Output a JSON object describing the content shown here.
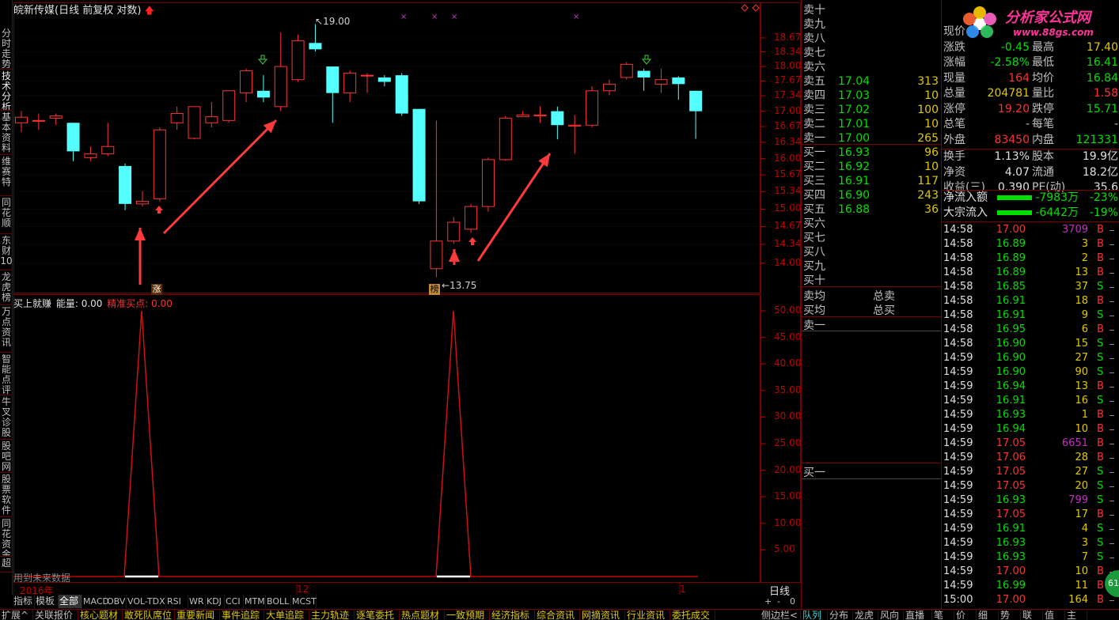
{
  "window": {
    "title": "皖新传媒(日线 前复权 对数)"
  },
  "left_tabs": [
    {
      "label": "分时走势"
    },
    {
      "label": "技术分析"
    },
    {
      "label": "基本资料"
    },
    {
      "label": "维赛特"
    },
    {
      "label": "同花顺"
    },
    {
      "label": "东财10"
    },
    {
      "label": "龙虎榜"
    },
    {
      "label": "万点资讯"
    },
    {
      "label": "智能点评"
    },
    {
      "label": "牛叉诊股"
    },
    {
      "label": "股吧网"
    },
    {
      "label": "股票软件"
    },
    {
      "label": "同花资金"
    },
    {
      "label": "超"
    }
  ],
  "main_chart": {
    "price_labels": {
      "high": "19.00",
      "low": "13.75"
    },
    "markers": {
      "zhang": "涨",
      "bang": "榜"
    },
    "y_ticks": [
      "18.67",
      "18.34",
      "18.00",
      "17.67",
      "17.34",
      "17.00",
      "16.67",
      "16.34",
      "16.00",
      "15.67",
      "15.34",
      "15.00",
      "14.67",
      "14.34",
      "14.00"
    ],
    "colors": {
      "up": "#ff3232",
      "down": "#54ffff",
      "grid": "#7a0000"
    }
  },
  "indicator": {
    "name": "买上就赚",
    "energy_label": "能量: 0.00",
    "signal_label": "精准买点: 0.00",
    "note": "用到未来数据",
    "y_ticks": [
      "50.00",
      "45.00",
      "40.00",
      "35.00",
      "30.00",
      "25.00",
      "20.00",
      "15.00",
      "10.00",
      "5.00"
    ]
  },
  "date_axis": {
    "labels": [
      "2016年",
      "12",
      "1"
    ],
    "period": "日线"
  },
  "indicator_tabs": [
    "指标",
    "模板",
    "全部",
    "MACD",
    "OBV",
    "VOL-TDX",
    "RSI",
    "WR",
    "KDJ",
    "CCI",
    "MTM",
    "BOLL",
    "MCST"
  ],
  "small_buttons": [
    "+",
    "-",
    "0"
  ],
  "order_book": {
    "sells": [
      {
        "label": "卖十",
        "price": "",
        "vol": ""
      },
      {
        "label": "卖九",
        "price": "",
        "vol": ""
      },
      {
        "label": "卖八",
        "price": "",
        "vol": ""
      },
      {
        "label": "卖七",
        "price": "",
        "vol": ""
      },
      {
        "label": "卖六",
        "price": "",
        "vol": ""
      },
      {
        "label": "卖五",
        "price": "17.04",
        "vol": "313"
      },
      {
        "label": "卖四",
        "price": "17.03",
        "vol": "10"
      },
      {
        "label": "卖三",
        "price": "17.02",
        "vol": "100"
      },
      {
        "label": "卖二",
        "price": "17.01",
        "vol": "10"
      },
      {
        "label": "卖一",
        "price": "17.00",
        "vol": "265"
      }
    ],
    "buys": [
      {
        "label": "买一",
        "price": "16.93",
        "vol": "96"
      },
      {
        "label": "买二",
        "price": "16.92",
        "vol": "10"
      },
      {
        "label": "买三",
        "price": "16.91",
        "vol": "117"
      },
      {
        "label": "买四",
        "price": "16.90",
        "vol": "243"
      },
      {
        "label": "买五",
        "price": "16.88",
        "vol": "36"
      },
      {
        "label": "买六",
        "price": "",
        "vol": ""
      },
      {
        "label": "买七",
        "price": "",
        "vol": ""
      },
      {
        "label": "买八",
        "price": "",
        "vol": ""
      },
      {
        "label": "买九",
        "price": "",
        "vol": ""
      },
      {
        "label": "买十",
        "price": "",
        "vol": ""
      }
    ],
    "avg_sell": "卖均",
    "avg_buy": "买均",
    "total_sell": "总卖",
    "total_buy": "总买",
    "queue_sell": "卖一",
    "queue_buy": "买一"
  },
  "quote": {
    "logo_text": "分析家公式网",
    "logo_url": "www.88gs.com",
    "rows": [
      {
        "l1": "现价",
        "v1": "",
        "l2": "",
        "v2": ""
      },
      {
        "l1": "涨跌",
        "v1": "-0.45",
        "l2": "最高",
        "v2": "17.40"
      },
      {
        "l1": "涨幅",
        "v1": "-2.58%",
        "l2": "最低",
        "v2": "16.41"
      },
      {
        "l1": "现量",
        "v1": "164",
        "l2": "均价",
        "v2": "16.84"
      },
      {
        "l1": "总量",
        "v1": "204781",
        "l2": "量比",
        "v2": "1.58"
      },
      {
        "l1": "涨停",
        "v1": "19.20",
        "l2": "跌停",
        "v2": "15.71"
      },
      {
        "l1": "总笔",
        "v1": "-",
        "l2": "每笔",
        "v2": "-"
      },
      {
        "l1": "外盘",
        "v1": "83450",
        "l2": "内盘",
        "v2": "121331"
      },
      {
        "l1": "换手",
        "v1": "1.13%",
        "l2": "股本",
        "v2": "19.9亿"
      },
      {
        "l1": "净资",
        "v1": "4.07",
        "l2": "流通",
        "v2": "18.2亿"
      },
      {
        "l1": "收益(三)",
        "v1": "0.390",
        "l2": "PE(动)",
        "v2": "35.6"
      }
    ],
    "flows": [
      {
        "label": "净流入额",
        "value": "-7983万",
        "pct": "-23%"
      },
      {
        "label": "大宗流入",
        "value": "-6442万",
        "pct": "-19%"
      }
    ]
  },
  "ticks": [
    {
      "t": "14:58",
      "p": "17.00",
      "v": "3709",
      "s": "B"
    },
    {
      "t": "14:58",
      "p": "16.89",
      "v": "3",
      "s": "B"
    },
    {
      "t": "14:58",
      "p": "16.89",
      "v": "2",
      "s": "B"
    },
    {
      "t": "14:58",
      "p": "16.89",
      "v": "13",
      "s": "B"
    },
    {
      "t": "14:58",
      "p": "16.85",
      "v": "37",
      "s": "S"
    },
    {
      "t": "14:58",
      "p": "16.91",
      "v": "18",
      "s": "B"
    },
    {
      "t": "14:58",
      "p": "16.91",
      "v": "9",
      "s": "S"
    },
    {
      "t": "14:58",
      "p": "16.95",
      "v": "6",
      "s": "B"
    },
    {
      "t": "14:58",
      "p": "16.90",
      "v": "15",
      "s": "S"
    },
    {
      "t": "14:59",
      "p": "16.90",
      "v": "27",
      "s": "S"
    },
    {
      "t": "14:59",
      "p": "16.90",
      "v": "90",
      "s": "S"
    },
    {
      "t": "14:59",
      "p": "16.94",
      "v": "13",
      "s": "B"
    },
    {
      "t": "14:59",
      "p": "16.91",
      "v": "16",
      "s": "S"
    },
    {
      "t": "14:59",
      "p": "16.93",
      "v": "1",
      "s": "B"
    },
    {
      "t": "14:59",
      "p": "16.94",
      "v": "10",
      "s": "B"
    },
    {
      "t": "14:59",
      "p": "17.05",
      "v": "6651",
      "s": "B"
    },
    {
      "t": "14:59",
      "p": "17.06",
      "v": "28",
      "s": "B"
    },
    {
      "t": "14:59",
      "p": "17.05",
      "v": "27",
      "s": "S"
    },
    {
      "t": "14:59",
      "p": "17.05",
      "v": "20",
      "s": "S"
    },
    {
      "t": "14:59",
      "p": "16.93",
      "v": "799",
      "s": "S"
    },
    {
      "t": "14:59",
      "p": "17.05",
      "v": "17",
      "s": "B"
    },
    {
      "t": "14:59",
      "p": "16.91",
      "v": "4",
      "s": "S"
    },
    {
      "t": "14:59",
      "p": "16.93",
      "v": "3",
      "s": "S"
    },
    {
      "t": "14:59",
      "p": "16.93",
      "v": "7",
      "s": "S"
    },
    {
      "t": "14:59",
      "p": "17.00",
      "v": "10",
      "s": "B"
    },
    {
      "t": "14:59",
      "p": "16.99",
      "v": "11",
      "s": "B"
    },
    {
      "t": "15:00",
      "p": "17.00",
      "v": "164",
      "s": "B"
    }
  ],
  "badge": "61",
  "bottom_tabs": [
    "扩展^",
    "关联报价",
    "核心题材",
    "敢死队席位",
    "重要新闻",
    "事件追踪",
    "大单追踪",
    "主力轨迹",
    "逐笔委托",
    "热点题材",
    "一致预期",
    "经济指标",
    "综合资讯",
    "网摘资讯",
    "行业资讯",
    "委托成交"
  ],
  "right_bottom_tabs": [
    "侧边栏<",
    "队列",
    "分布",
    "龙虎",
    "风向",
    "直播",
    "笔",
    "价",
    "细",
    "势",
    "联",
    "值",
    "主"
  ],
  "candles": [
    {
      "o": 16.75,
      "c": 16.87,
      "h": 17.0,
      "l": 16.55
    },
    {
      "o": 16.8,
      "c": 16.8,
      "h": 16.95,
      "l": 16.6
    },
    {
      "o": 16.85,
      "c": 16.9,
      "h": 16.95,
      "l": 16.7
    },
    {
      "o": 16.75,
      "c": 16.15,
      "h": 16.75,
      "l": 15.95
    },
    {
      "o": 16.02,
      "c": 16.1,
      "h": 16.25,
      "l": 15.95
    },
    {
      "o": 16.1,
      "c": 16.25,
      "h": 16.75,
      "l": 16.05
    },
    {
      "o": 15.85,
      "c": 15.1,
      "h": 15.9,
      "l": 14.98
    },
    {
      "o": 15.1,
      "c": 15.15,
      "h": 15.35,
      "l": 15.05
    },
    {
      "o": 15.2,
      "c": 16.6,
      "h": 16.65,
      "l": 15.15
    },
    {
      "o": 16.75,
      "c": 16.95,
      "h": 17.1,
      "l": 16.6
    },
    {
      "o": 16.42,
      "c": 17.1,
      "h": 17.1,
      "l": 16.4
    },
    {
      "o": 16.75,
      "c": 16.88,
      "h": 17.2,
      "l": 16.65
    },
    {
      "o": 16.8,
      "c": 17.45,
      "h": 17.45,
      "l": 16.75
    },
    {
      "o": 17.4,
      "c": 17.9,
      "h": 17.95,
      "l": 17.2
    },
    {
      "o": 17.45,
      "c": 17.3,
      "h": 17.8,
      "l": 17.2
    },
    {
      "o": 17.1,
      "c": 18.0,
      "h": 18.8,
      "l": 17.0
    },
    {
      "o": 17.7,
      "c": 18.6,
      "h": 18.75,
      "l": 17.65
    },
    {
      "o": 18.55,
      "c": 18.4,
      "h": 19.0,
      "l": 18.35
    },
    {
      "o": 18.0,
      "c": 17.4,
      "h": 18.0,
      "l": 16.75
    },
    {
      "o": 17.4,
      "c": 17.85,
      "h": 17.9,
      "l": 17.2
    },
    {
      "o": 17.8,
      "c": 17.8,
      "h": 17.85,
      "l": 17.4
    },
    {
      "o": 17.75,
      "c": 17.65,
      "h": 17.8,
      "l": 17.55
    },
    {
      "o": 17.8,
      "c": 16.95,
      "h": 17.85,
      "l": 16.9
    },
    {
      "o": 17.05,
      "c": 15.15,
      "h": 17.05,
      "l": 15.1
    },
    {
      "o": 13.9,
      "c": 14.4,
      "h": 16.8,
      "l": 13.75
    },
    {
      "o": 14.4,
      "c": 14.75,
      "h": 14.85,
      "l": 14.35
    },
    {
      "o": 14.62,
      "c": 15.05,
      "h": 15.1,
      "l": 14.55
    },
    {
      "o": 15.05,
      "c": 15.98,
      "h": 16.02,
      "l": 14.95
    },
    {
      "o": 15.98,
      "c": 16.85,
      "h": 16.9,
      "l": 15.95
    },
    {
      "o": 16.88,
      "c": 16.92,
      "h": 17.0,
      "l": 16.88
    },
    {
      "o": 16.9,
      "c": 16.92,
      "h": 17.1,
      "l": 16.75
    },
    {
      "o": 17.0,
      "c": 16.7,
      "h": 17.1,
      "l": 16.4
    },
    {
      "o": 16.68,
      "c": 16.7,
      "h": 16.92,
      "l": 16.1
    },
    {
      "o": 16.7,
      "c": 17.45,
      "h": 17.55,
      "l": 16.65
    },
    {
      "o": 17.45,
      "c": 17.6,
      "h": 17.7,
      "l": 17.35
    },
    {
      "o": 17.75,
      "c": 18.05,
      "h": 18.1,
      "l": 17.7
    },
    {
      "o": 17.9,
      "c": 17.75,
      "h": 17.95,
      "l": 17.45
    },
    {
      "o": 17.6,
      "c": 17.7,
      "h": 17.95,
      "l": 17.4
    },
    {
      "o": 17.75,
      "c": 17.6,
      "h": 17.78,
      "l": 17.25
    },
    {
      "o": 17.45,
      "c": 17.0,
      "h": 17.45,
      "l": 16.41
    }
  ]
}
